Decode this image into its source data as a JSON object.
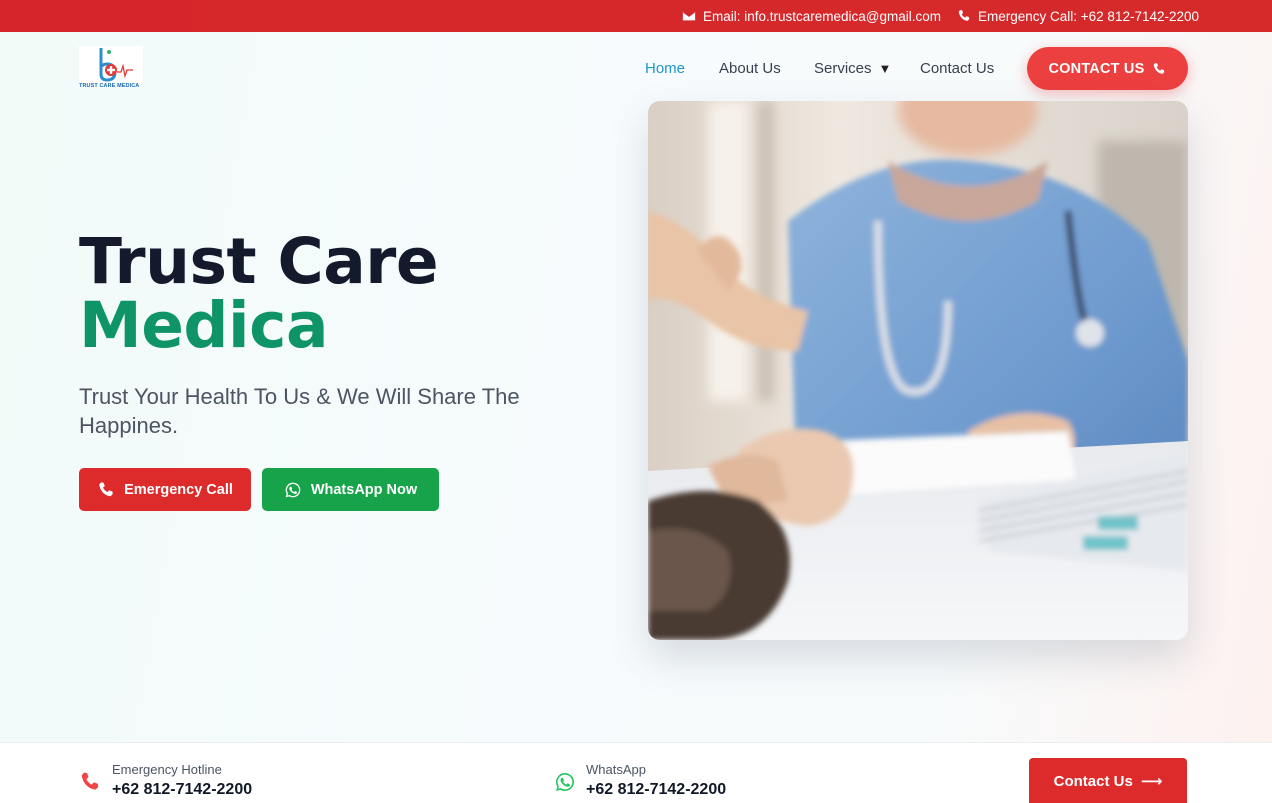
{
  "topbar": {
    "email": "Email: info.trustcaremedica@gmail.com",
    "phone": "Emergency Call: +62 812-7142-2200",
    "email_icon": "envelope-icon",
    "phone_icon": "phone-icon"
  },
  "header": {
    "logo_text": "TRUST CARE MEDICA",
    "nav": {
      "home": "Home",
      "about": "About Us",
      "services": "Services",
      "contact": "Contact Us"
    },
    "cta": "CONTACT US"
  },
  "hero": {
    "title_line1": "Trust Care",
    "title_line2": "Medica",
    "subtitle": "Trust Your Health To Us & We Will Share The Happines.",
    "emergency_button": "Emergency Call",
    "whatsapp_button": "WhatsApp Now"
  },
  "bottombar": {
    "hotline_label": "Emergency Hotline",
    "hotline_value": "+62 812-7142-2200",
    "whatsapp_label": "WhatsApp",
    "whatsapp_value": "+62 812-7142-2200",
    "contact_button": "Contact Us"
  },
  "colors": {
    "brand_red": "#dd2a2a",
    "brand_green": "#0f9467",
    "whatsapp_green": "#16a34a",
    "nav_active": "#1e97c9"
  }
}
